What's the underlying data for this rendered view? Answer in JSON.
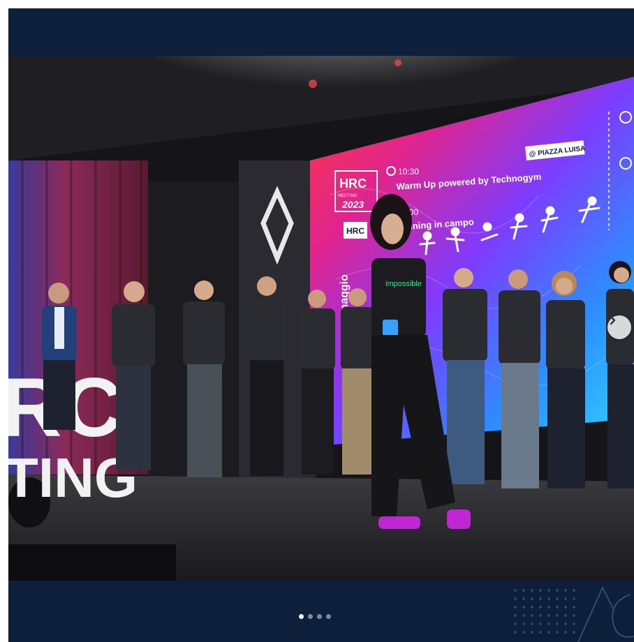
{
  "screen": {
    "event_name": "HRC",
    "event_sub": "MEETING",
    "event_year": "2023",
    "event_badge": "HRC",
    "month_label": "maggio",
    "schedule": [
      {
        "time": "10:30",
        "title": "Warm Up powered by Technogym",
        "location": "@ PIAZZA LUISA"
      },
      {
        "time": "11:00",
        "title": "Training in campo"
      }
    ]
  },
  "stage_letters": {
    "line1": "RC",
    "line2": "TING"
  },
  "shirt_text": "impossible",
  "carousel": {
    "page_count": 4,
    "active_index": 0
  },
  "colors": {
    "band": "#0d1f3a",
    "accent_pink": "#ff3da8",
    "accent_blue": "#2ac3ff"
  }
}
